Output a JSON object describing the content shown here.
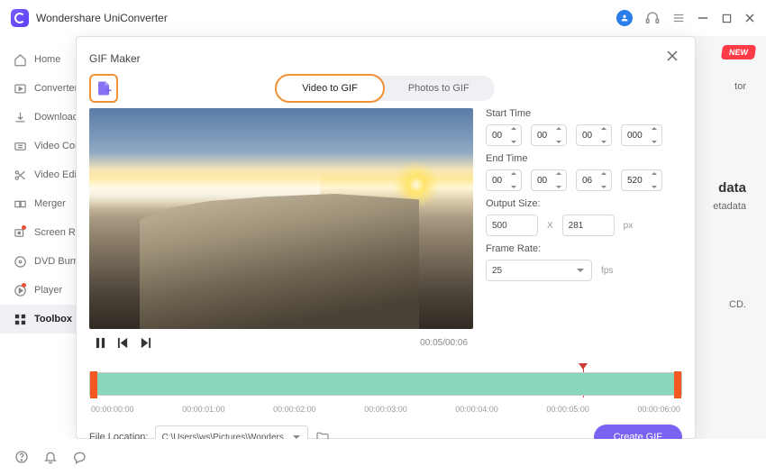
{
  "app": {
    "title": "Wondershare UniConverter"
  },
  "sidebar": {
    "items": [
      {
        "label": "Home"
      },
      {
        "label": "Converter"
      },
      {
        "label": "Downloader"
      },
      {
        "label": "Video Compressor"
      },
      {
        "label": "Video Editor"
      },
      {
        "label": "Merger"
      },
      {
        "label": "Screen Recorder"
      },
      {
        "label": "DVD Burner"
      },
      {
        "label": "Player"
      },
      {
        "label": "Toolbox"
      }
    ]
  },
  "background": {
    "badge": "NEW",
    "line1": "tor",
    "line2": "data",
    "line3": "etadata",
    "line4": "CD."
  },
  "modal": {
    "title": "GIF Maker",
    "tabs": {
      "video": "Video to GIF",
      "photos": "Photos to GIF"
    },
    "player": {
      "time": "00:05/00:06"
    },
    "settings": {
      "start_label": "Start Time",
      "start": {
        "hh": "00",
        "mm": "00",
        "ss": "00",
        "ms": "000"
      },
      "end_label": "End Time",
      "end": {
        "hh": "00",
        "mm": "00",
        "ss": "06",
        "ms": "520"
      },
      "output_label": "Output Size:",
      "output": {
        "w": "500",
        "sep": "X",
        "h": "281",
        "unit": "px"
      },
      "rate_label": "Frame Rate:",
      "rate": {
        "value": "25",
        "unit": "fps"
      }
    },
    "ruler": [
      "00:00:00:00",
      "00:00:01:00",
      "00:00:02:00",
      "00:00:03:00",
      "00:00:04:00",
      "00:00:05:00",
      "00:00:06:00"
    ],
    "footer": {
      "loc_label": "File Location:",
      "path": "C:\\Users\\ws\\Pictures\\Wonders",
      "create": "Create GIF"
    }
  }
}
